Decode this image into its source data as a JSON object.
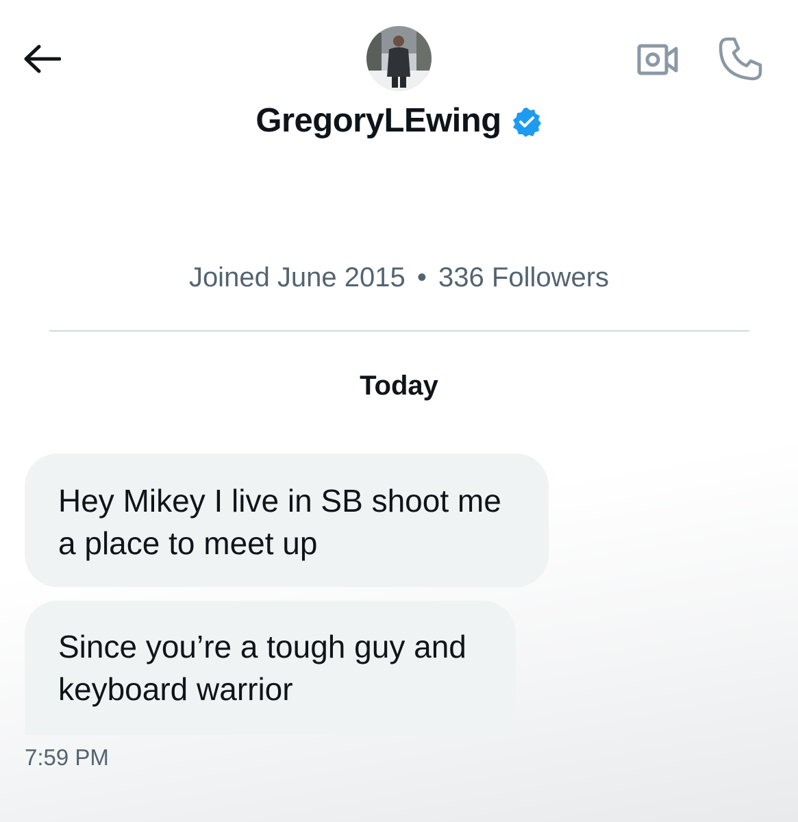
{
  "header": {
    "back_icon": "arrow-left-icon",
    "avatar_alt": "Profile photo",
    "video_icon": "video-camera-icon",
    "call_icon": "phone-icon",
    "display_name": "GregoryLEwing",
    "verified_icon": "verified-badge-icon",
    "verified_color": "#1d9bf0"
  },
  "profile_meta": {
    "joined": "Joined June 2015",
    "separator": "•",
    "followers": "336 Followers"
  },
  "conversation": {
    "date_separator": "Today",
    "messages": [
      {
        "line1": "Hey Mikey I live in SB shoot me",
        "line2": "a place to meet up"
      },
      {
        "line1": "Since you’re a tough guy and",
        "line2": "keyboard warrior"
      }
    ],
    "timestamp": "7:59 PM"
  },
  "colors": {
    "text_primary": "#0f1419",
    "text_secondary": "#536471",
    "bubble_bg": "#eff3f4",
    "divider": "#cfd9de",
    "icon_gray": "#8b98a5"
  }
}
